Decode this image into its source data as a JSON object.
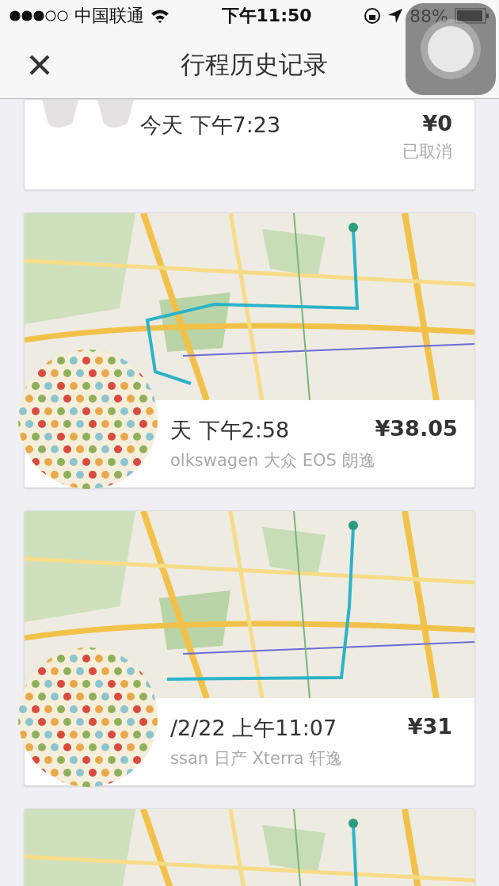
{
  "status_bar": {
    "carrier": "中国联通",
    "time": "下午11:50",
    "battery": "88%"
  },
  "nav": {
    "title": "行程历史记录"
  },
  "trips": [
    {
      "kind": "plain",
      "time": "今天 下午7:23",
      "fare": "¥0",
      "status": "已取消"
    },
    {
      "kind": "map",
      "time": "天 下午2:58",
      "fare": "¥38.05",
      "vehicle": "olkswagen 大众 EOS 朗逸"
    },
    {
      "kind": "map",
      "time": "/2/22 上午11:07",
      "fare": "¥31",
      "vehicle": "ssan 日产 Xterra 轩逸"
    },
    {
      "kind": "map_only"
    }
  ]
}
